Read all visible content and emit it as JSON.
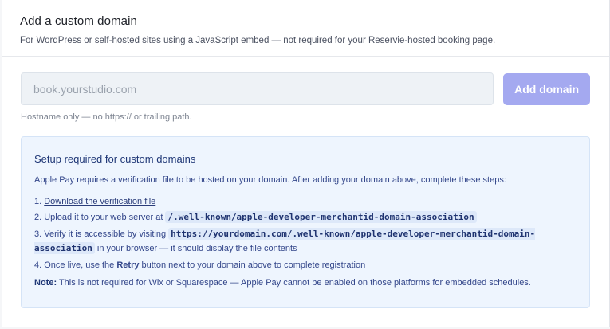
{
  "header": {
    "title": "Add a custom domain",
    "subtitle": "For WordPress or self-hosted sites using a JavaScript embed — not required for your Reservie-hosted booking page."
  },
  "form": {
    "input_value": "",
    "input_placeholder": "book.yourstudio.com",
    "add_button_label": "Add domain",
    "hint": "Hostname only — no https:// or trailing path."
  },
  "setup": {
    "title": "Setup required for custom domains",
    "intro": "Apple Pay requires a verification file to be hosted on your domain. After adding your domain above, complete these steps:",
    "step1_prefix": "1. ",
    "step1_link": "Download the verification file",
    "step2_prefix": "2. Upload it to your web server at ",
    "step2_code": "/.well-known/apple-developer-merchantid-domain-association",
    "step3_prefix": "3. Verify it is accessible by visiting ",
    "step3_code": "https://yourdomain.com/.well-known/apple-developer-merchantid-domain-association",
    "step3_suffix": " in your browser — it should display the file contents",
    "step4_prefix": "4. Once live, use the ",
    "step4_bold": "Retry",
    "step4_suffix": " button next to your domain above to complete registration",
    "note_label": "Note:",
    "note_text": " This is not required for Wix or Squarespace — Apple Pay cannot be enabled on those platforms for embedded schedules."
  },
  "colors": {
    "accent_button": "#a4a9f0",
    "info_box_bg": "#eef5fe",
    "info_text": "#33468a"
  }
}
